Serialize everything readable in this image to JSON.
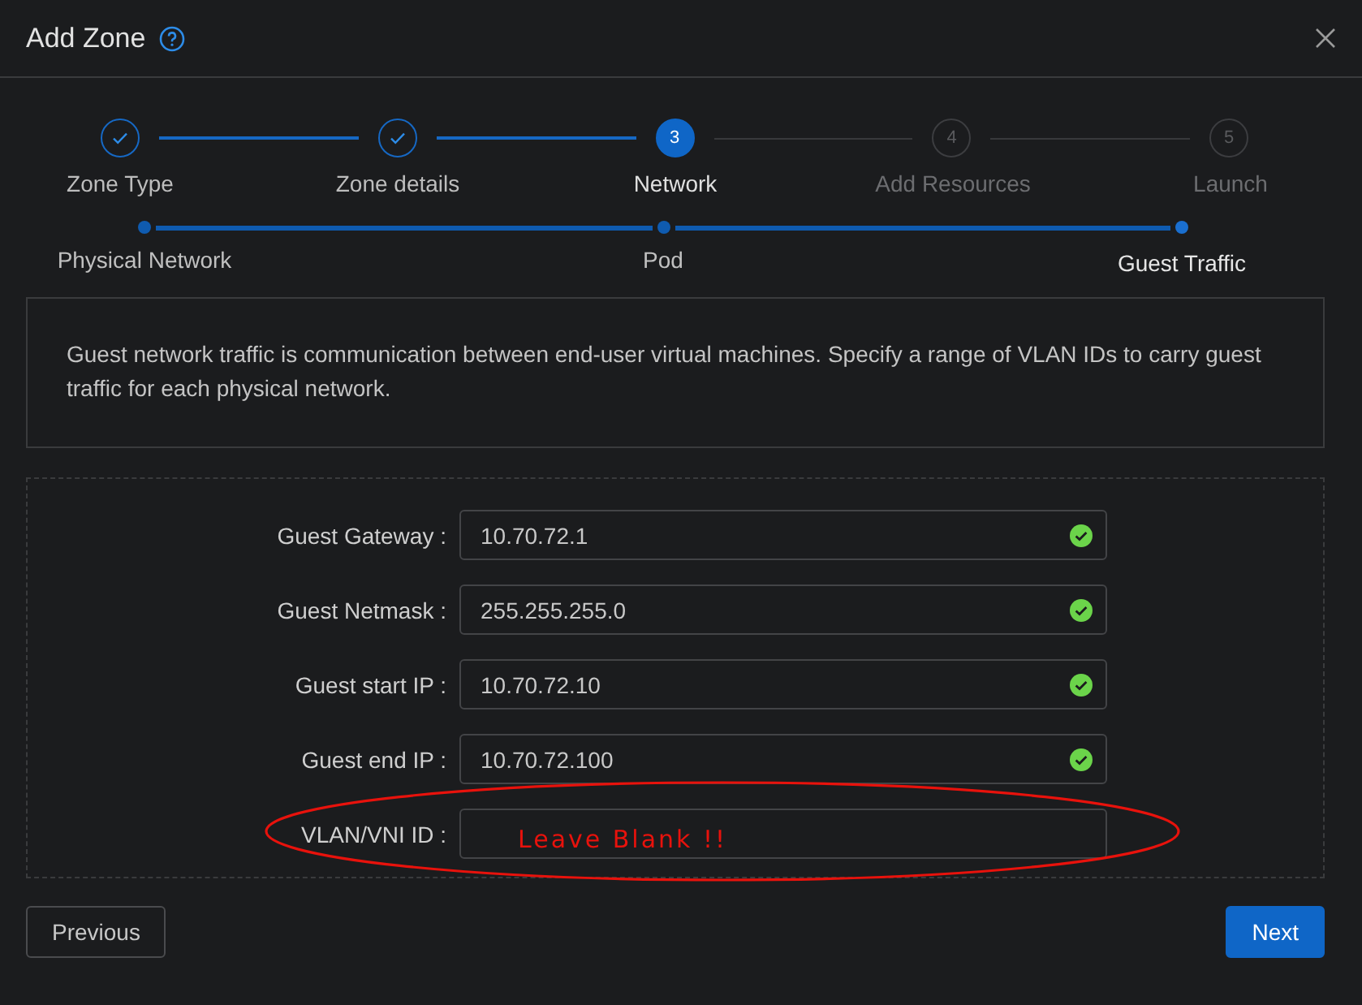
{
  "window": {
    "title": "Add Zone"
  },
  "steps": [
    {
      "label": "Zone Type",
      "done": true,
      "selected": false
    },
    {
      "label": "Zone details",
      "done": true,
      "selected": false
    },
    {
      "number": "3",
      "label": "Network",
      "done": false,
      "selected": true
    },
    {
      "number": "4",
      "label": "Add Resources",
      "done": false,
      "selected": false
    },
    {
      "number": "5",
      "label": "Launch",
      "done": false,
      "selected": false
    }
  ],
  "sub_steps": [
    {
      "label": "Physical Network",
      "selected": false
    },
    {
      "label": "Pod",
      "selected": false
    },
    {
      "label": "Guest Traffic",
      "selected": true
    }
  ],
  "info": "Guest network traffic is communication between end-user virtual machines. Specify a range of VLAN IDs to carry guest traffic for each physical network.",
  "fields": [
    {
      "label": "Guest Gateway :",
      "value": "10.70.72.1",
      "valid": true
    },
    {
      "label": "Guest Netmask :",
      "value": "255.255.255.0",
      "valid": true
    },
    {
      "label": "Guest start IP :",
      "value": "10.70.72.10",
      "valid": true
    },
    {
      "label": "Guest end IP :",
      "value": "10.70.72.100",
      "valid": true
    },
    {
      "label": "VLAN/VNI ID :",
      "valid": false,
      "annotation": "Leave Blank !!"
    }
  ],
  "buttons": {
    "previous": "Previous",
    "next": "Next"
  }
}
